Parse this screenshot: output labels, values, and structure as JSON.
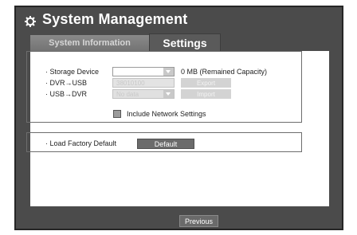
{
  "window": {
    "title": "System Management"
  },
  "tabs": [
    {
      "label": "System Information",
      "active": false
    },
    {
      "label": "Settings",
      "active": true
    }
  ],
  "storage": {
    "storage_device_label": "· Storage Device",
    "storage_device_value": "",
    "capacity_text": "0 MB (Remained Capacity)",
    "dvr_to_usb_label": "· DVR→USB",
    "dvr_to_usb_value": "38010100",
    "export_label": "Export",
    "usb_to_dvr_label": "· USB→DVR",
    "usb_to_dvr_value": "No data",
    "import_label": "Import",
    "include_network_label": "Include Network Settings",
    "include_network_checked": false
  },
  "factory": {
    "label": "· Load Factory Default",
    "button_label": "Default"
  },
  "footer": {
    "previous_label": "Previous"
  },
  "icons": {
    "title_icon": "gear-icon",
    "dropdown_icon": "chevron-down-icon"
  },
  "colors": {
    "frame_bg": "#4b4b4b",
    "panel_bg": "#ffffff",
    "active_tab": "#5a5a5a",
    "inactive_tab": "#7f7f7f"
  }
}
